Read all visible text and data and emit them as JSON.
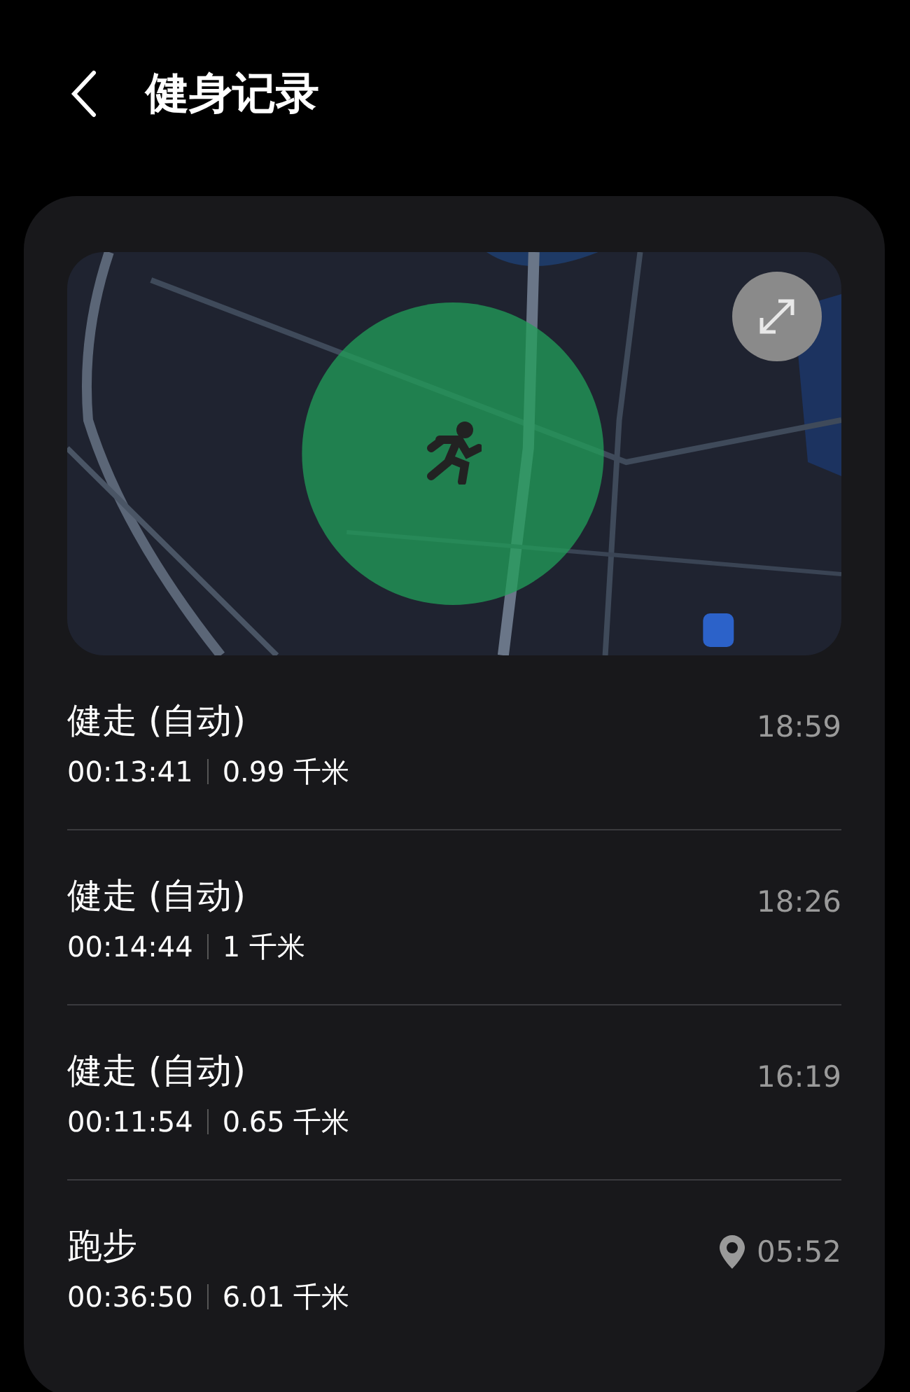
{
  "header": {
    "title": "健身记录"
  },
  "records": [
    {
      "title": "健走 (自动)",
      "duration": "00:13:41",
      "distance": "0.99 千米",
      "time": "18:59",
      "has_location": false
    },
    {
      "title": "健走 (自动)",
      "duration": "00:14:44",
      "distance": "1 千米",
      "time": "18:26",
      "has_location": false
    },
    {
      "title": "健走 (自动)",
      "duration": "00:11:54",
      "distance": "0.65 千米",
      "time": "16:19",
      "has_location": false
    },
    {
      "title": "跑步",
      "duration": "00:36:50",
      "distance": "6.01 千米",
      "time": "05:52",
      "has_location": true
    }
  ]
}
